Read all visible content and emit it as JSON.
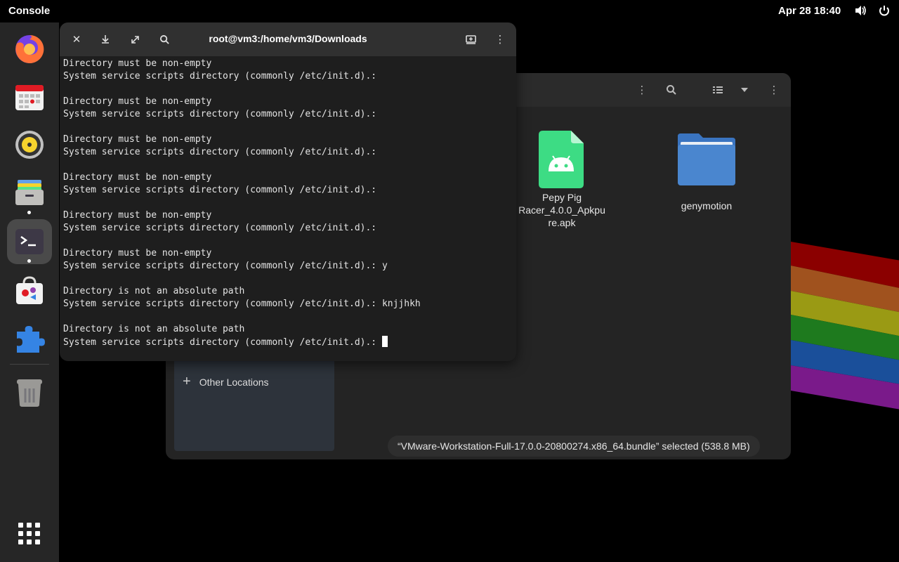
{
  "topbar": {
    "app_name": "Console",
    "clock": "Apr 28  18:40",
    "icons": [
      "volume-icon",
      "power-icon"
    ]
  },
  "dock": {
    "items": [
      {
        "name": "firefox",
        "icon": "firefox-icon"
      },
      {
        "name": "calendar",
        "icon": "calendar-icon"
      },
      {
        "name": "rhythmbox",
        "icon": "music-icon"
      },
      {
        "name": "files",
        "icon": "files-icon",
        "running": true
      },
      {
        "name": "console",
        "icon": "terminal-icon",
        "running": true,
        "active": true
      },
      {
        "name": "software",
        "icon": "software-icon"
      },
      {
        "name": "extensions",
        "icon": "puzzle-icon"
      },
      {
        "name": "trash",
        "icon": "trash-icon"
      },
      {
        "name": "app-grid",
        "icon": "app-grid-icon"
      }
    ]
  },
  "terminal": {
    "title": "root@vm3:/home/vm3/Downloads",
    "lines": [
      "Directory must be non-empty",
      "System service scripts directory (commonly /etc/init.d).:",
      "",
      "Directory must be non-empty",
      "System service scripts directory (commonly /etc/init.d).:",
      "",
      "Directory must be non-empty",
      "System service scripts directory (commonly /etc/init.d).:",
      "",
      "Directory must be non-empty",
      "System service scripts directory (commonly /etc/init.d).:",
      "",
      "Directory must be non-empty",
      "System service scripts directory (commonly /etc/init.d).:",
      "",
      "Directory must be non-empty",
      "System service scripts directory (commonly /etc/init.d).: y",
      "",
      "Directory is not an absolute path",
      "System service scripts directory (commonly /etc/init.d).: knjjhkh",
      "",
      "Directory is not an absolute path",
      "System service scripts directory (commonly /etc/init.d).: "
    ]
  },
  "files": {
    "items": [
      {
        "name": "Pepy Pig Racer_4.0.0_Apkpure.apk",
        "line1": "Pepy Pig",
        "line2": "Racer_4.0.0_Apkpu",
        "line3": "re.apk",
        "icon": "android-apk-icon"
      },
      {
        "name": "genymotion",
        "line1": "genymotion",
        "icon": "folder-icon"
      }
    ],
    "sidebar": {
      "other_locations": "Other Locations"
    },
    "status": "“VMware-Workstation-Full-17.0.0-20800274.x86_64.bundle” selected  (538.8 MB)"
  },
  "colors": {
    "accent_blue": "#3584e4",
    "apk_green": "#3ddc84",
    "folder_blue": "#4a86cf"
  }
}
